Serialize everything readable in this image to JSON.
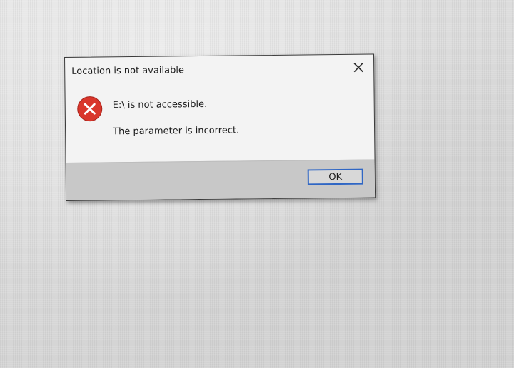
{
  "dialog": {
    "title": "Location is not available",
    "close_icon": "close-icon",
    "error_icon": "error-icon",
    "message_primary": "E:\\ is not accessible.",
    "message_secondary": "The parameter is incorrect.",
    "ok_label": "OK"
  },
  "colors": {
    "error_red": "#d9362b",
    "ok_border": "#2f66c4",
    "dialog_bg": "#f3f3f3",
    "button_bar_bg": "#c8c8c8"
  }
}
